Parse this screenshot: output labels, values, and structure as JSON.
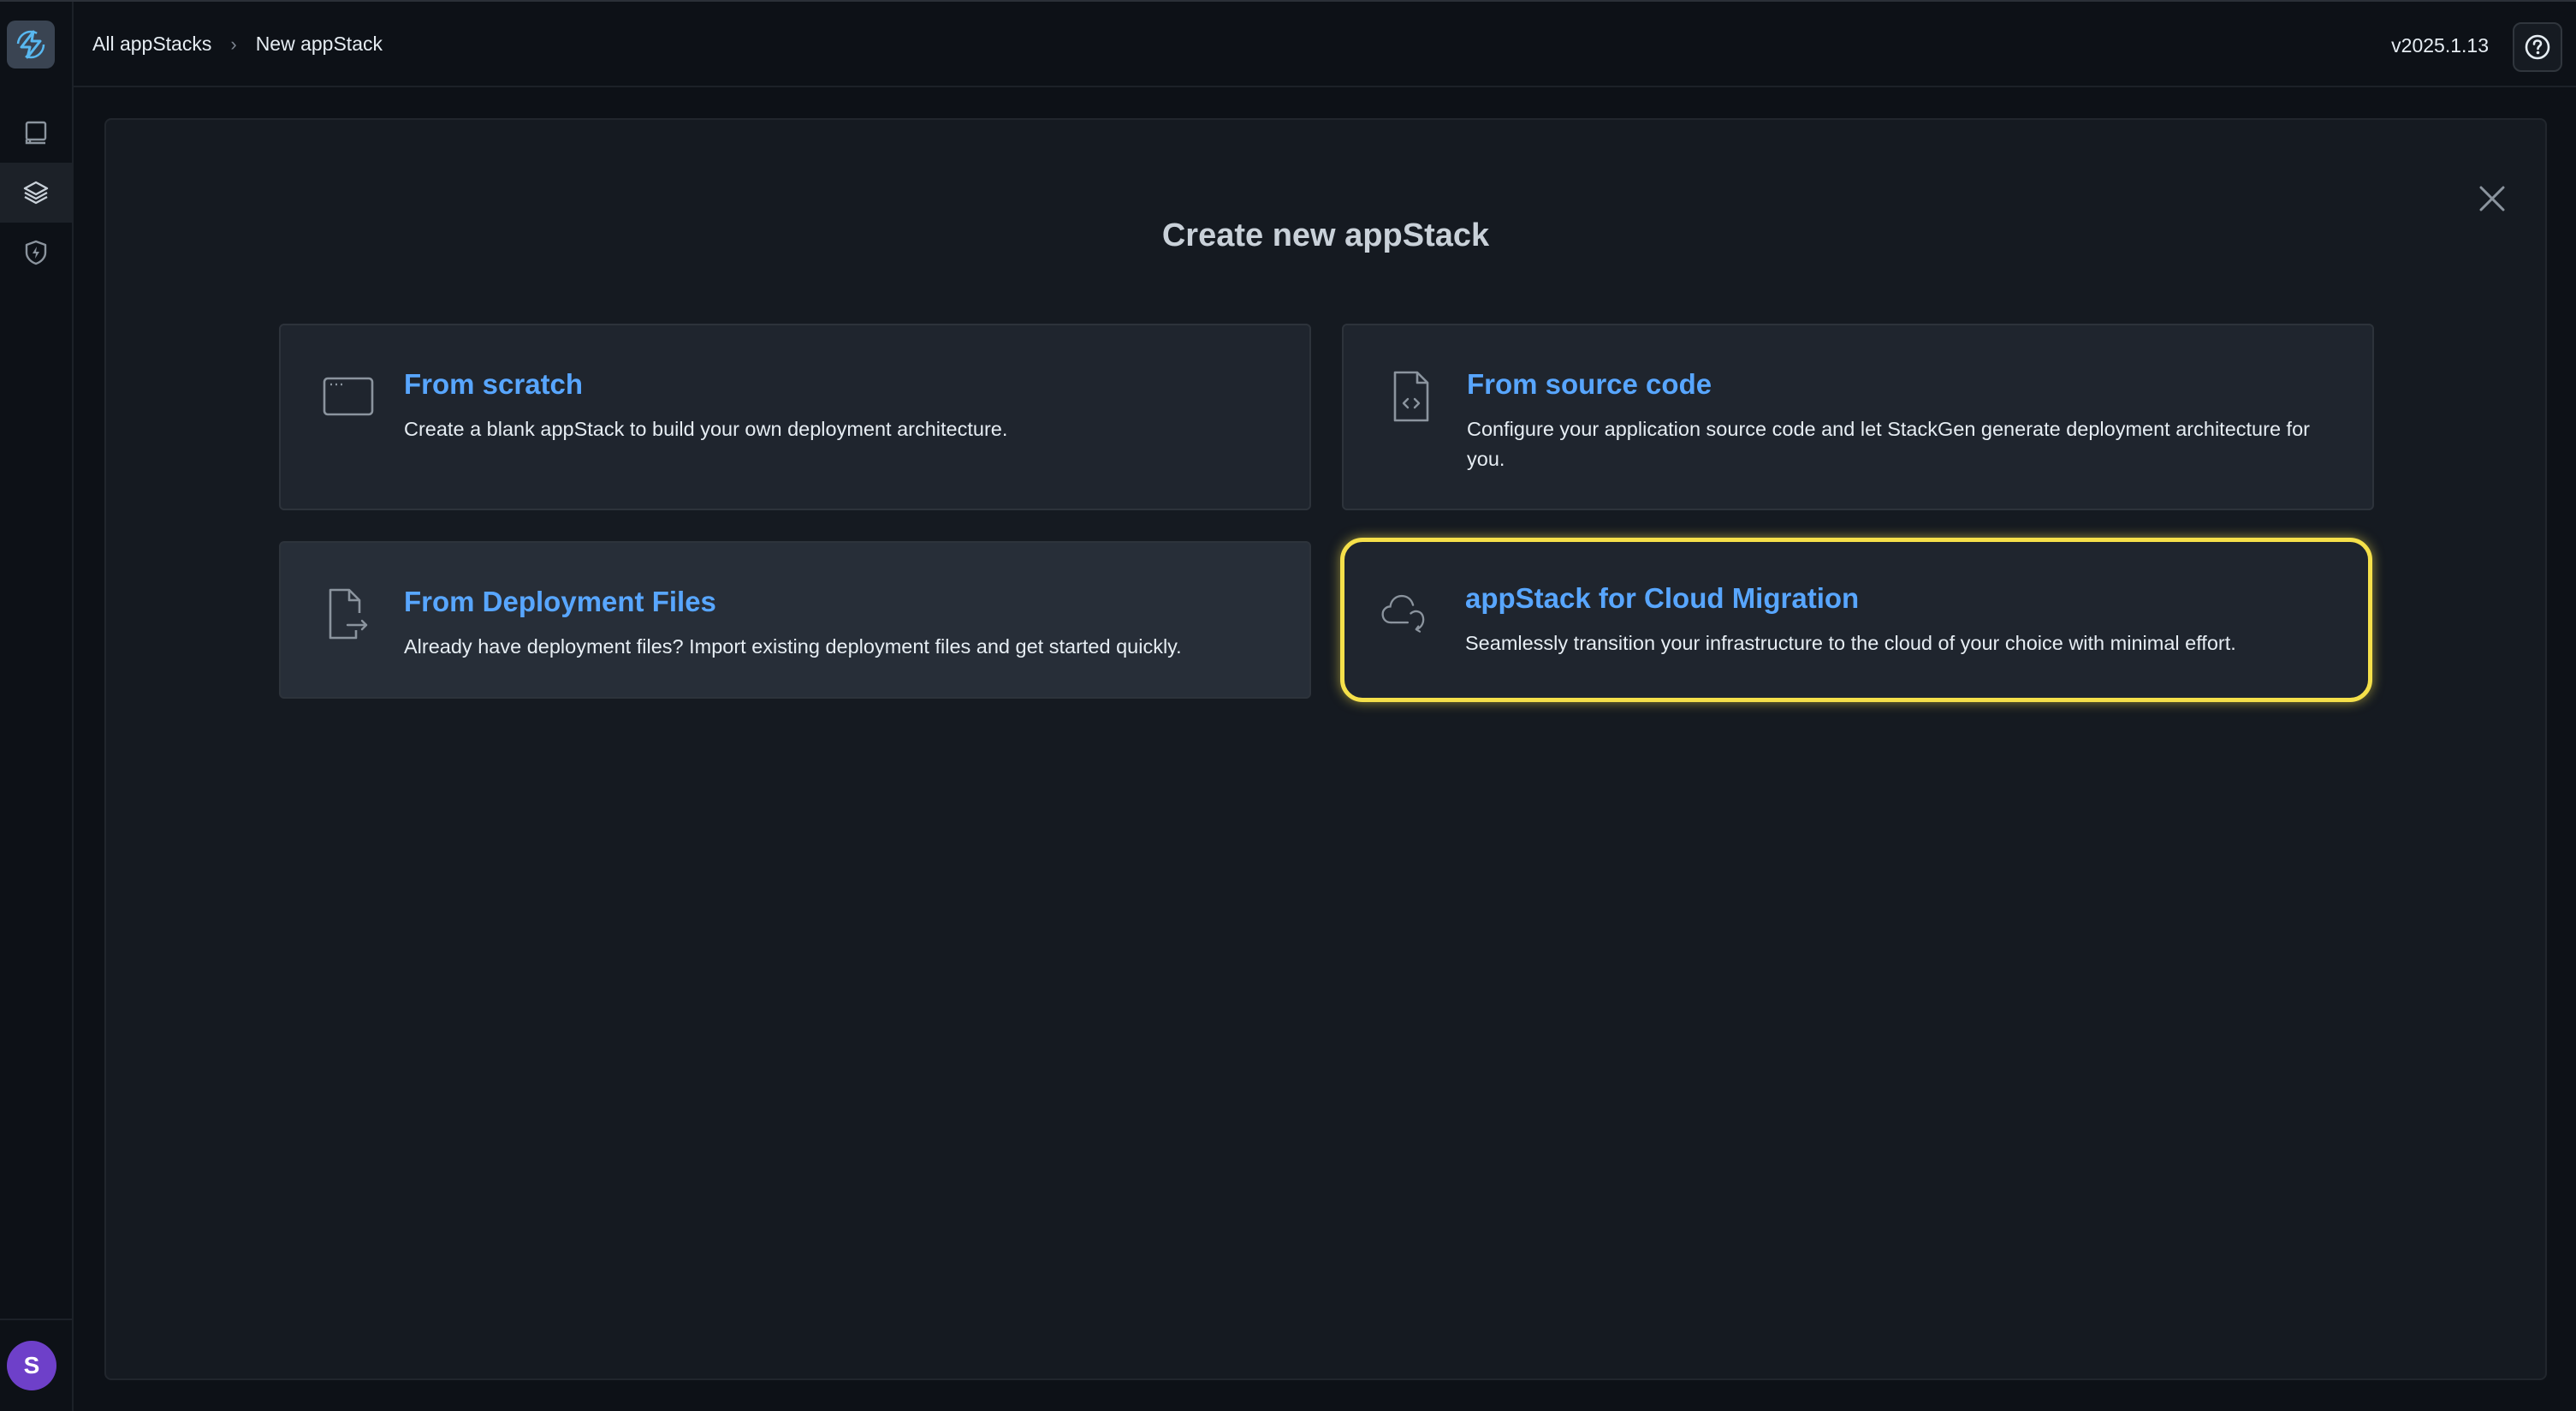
{
  "breadcrumb": {
    "root": "All appStacks",
    "current": "New appStack"
  },
  "header": {
    "version": "v2025.1.13"
  },
  "user": {
    "initial": "S"
  },
  "dialog": {
    "title": "Create new appStack"
  },
  "options": [
    {
      "icon": "browser-window-icon",
      "title": "From scratch",
      "description": "Create a blank appStack to build your own deployment architecture."
    },
    {
      "icon": "code-file-icon",
      "title": "From source code",
      "description": "Configure your application source code and let StackGen generate deployment architecture for you."
    },
    {
      "icon": "file-import-icon",
      "title": "From Deployment Files",
      "description": "Already have deployment files? Import existing deployment files and get started quickly."
    },
    {
      "icon": "cloud-migration-icon",
      "title": "appStack for Cloud Migration",
      "description": "Seamlessly transition your infrastructure to the cloud of your choice with minimal effort."
    }
  ],
  "colors": {
    "accent": "#58a6ff",
    "highlight": "#f5e04a",
    "avatar": "#6e40c9"
  }
}
